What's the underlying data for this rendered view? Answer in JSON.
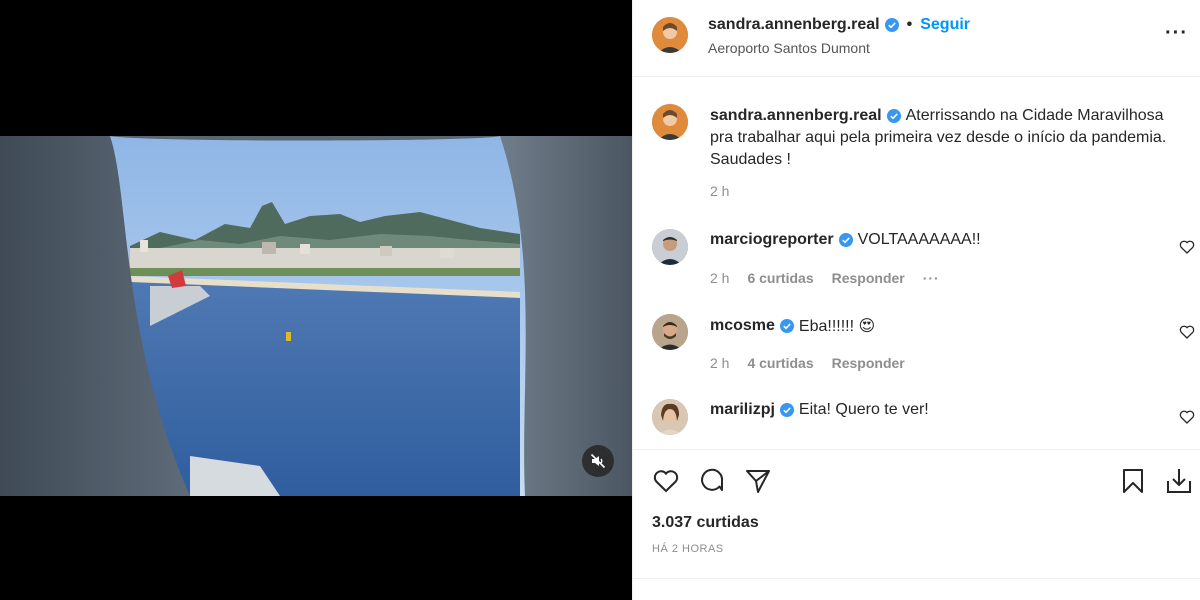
{
  "post": {
    "username": "sandra.annenberg.real",
    "follow_label": "Seguir",
    "separator": "•",
    "location": "Aeroporto Santos Dumont",
    "more_label": "···"
  },
  "caption": {
    "username": "sandra.annenberg.real",
    "text": "Aterrissando na Cidade Maravilhosa pra trabalhar aqui pela primeira vez desde o início da pandemia. Saudades !",
    "time": "2 h"
  },
  "comments": [
    {
      "username": "marciogreporter",
      "text": "VOLTAAAAAAA!!",
      "time": "2 h",
      "likes": "6 curtidas",
      "reply": "Responder",
      "more": "···"
    },
    {
      "username": "mcosme",
      "text": "Eba!!!!!! 😍",
      "time": "2 h",
      "likes": "4 curtidas",
      "reply": "Responder"
    },
    {
      "username": "marilizpj",
      "text": "Eita! Quero te ver!"
    }
  ],
  "actions": {
    "likes_count": "3.037 curtidas",
    "posted_time": "HÁ 2 HORAS"
  },
  "colors": {
    "accent": "#0095f6",
    "verified": "#3897f0",
    "text": "#262626",
    "muted": "#8e8e8e"
  },
  "icons": [
    "verified-icon",
    "heart-icon",
    "comment-icon",
    "share-icon",
    "bookmark-icon",
    "download-icon",
    "mute-icon",
    "more-icon"
  ]
}
